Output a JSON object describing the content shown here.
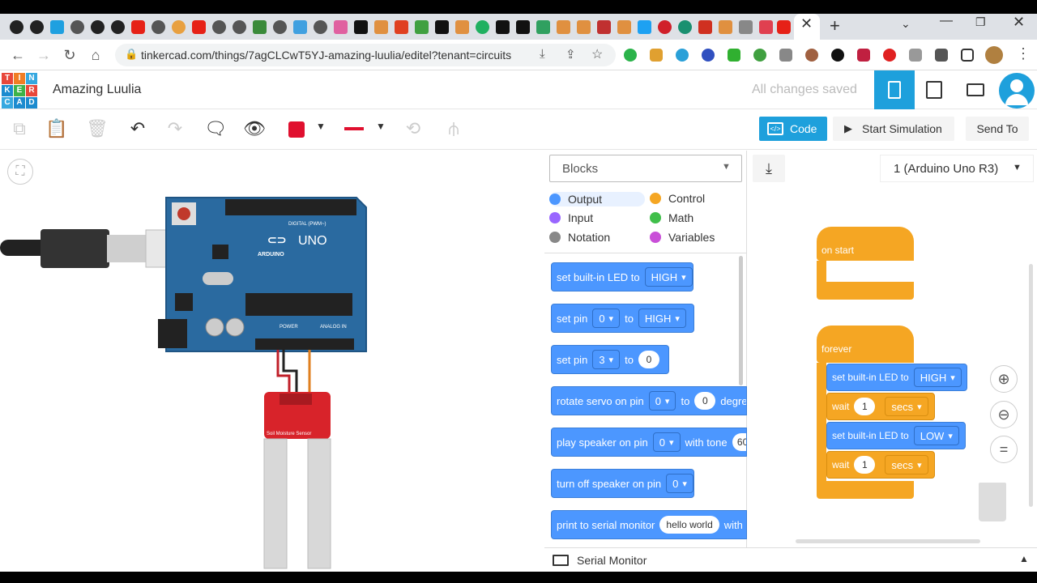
{
  "browser": {
    "url": "tinkercad.com/things/7agCLCwT5YJ-amazing-luulia/editel?tenant=circuits"
  },
  "header": {
    "project_title": "Amazing Luulia",
    "save_status": "All changes saved",
    "logo_letters": [
      "T",
      "I",
      "N",
      "K",
      "E",
      "R",
      "C",
      "A",
      "D"
    ]
  },
  "toolbar": {
    "code_label": "Code",
    "start_sim_label": "Start Simulation",
    "send_to_label": "Send To"
  },
  "code_panel": {
    "mode_select": "Blocks",
    "board_select": "1 (Arduino Uno R3)",
    "categories": [
      {
        "label": "Output",
        "color": "#4c97ff"
      },
      {
        "label": "Control",
        "color": "#f5a623"
      },
      {
        "label": "Input",
        "color": "#9966ff"
      },
      {
        "label": "Math",
        "color": "#40bf4a"
      },
      {
        "label": "Notation",
        "color": "#888888"
      },
      {
        "label": "Variables",
        "color": "#c94fd8"
      }
    ],
    "palette": {
      "b1": {
        "text": "set built-in LED to",
        "dd": "HIGH"
      },
      "b2": {
        "text": "set pin",
        "dd1": "0",
        "to": "to",
        "dd2": "HIGH"
      },
      "b3": {
        "text": "set pin",
        "dd1": "3",
        "to": "to",
        "val": "0"
      },
      "b4": {
        "text": "rotate servo on pin",
        "dd1": "0",
        "to": "to",
        "val": "0",
        "tail": "degre"
      },
      "b5": {
        "text": "play speaker on pin",
        "dd1": "0",
        "tail": "with tone",
        "val": "60"
      },
      "b6": {
        "text": "turn off speaker on pin",
        "dd1": "0"
      },
      "b7": {
        "text": "print to serial monitor",
        "val": "hello world",
        "tail": "with"
      }
    },
    "serial_monitor_label": "Serial Monitor"
  },
  "workspace": {
    "on_start": "on start",
    "forever": "forever",
    "s1": {
      "text": "set built-in LED to",
      "dd": "HIGH"
    },
    "w1": {
      "text": "wait",
      "val": "1",
      "dd": "secs"
    },
    "s2": {
      "text": "set built-in LED to",
      "dd": "LOW"
    },
    "w2": {
      "text": "wait",
      "val": "1",
      "dd": "secs"
    }
  },
  "circuit": {
    "uno_label": "UNO",
    "arduino_label": "ARDUINO",
    "digital_label": "DIGITAL (PWM~)",
    "power_label": "POWER",
    "analog_label": "ANALOG IN",
    "sensor_label": "Soil Moisture Sensor"
  }
}
